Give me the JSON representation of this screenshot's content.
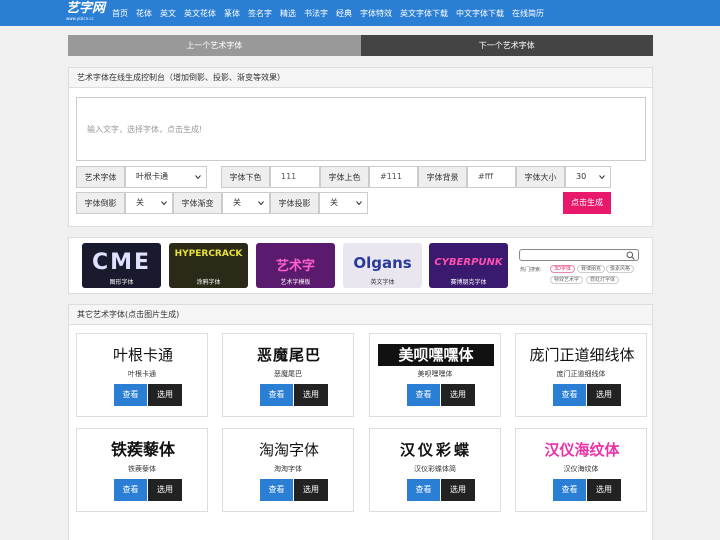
{
  "logo": {
    "main": "艺字网",
    "sub": "www.yizicn.cc"
  },
  "nav": [
    "首页",
    "花体",
    "英文",
    "英文花体",
    "篆体",
    "签名字",
    "精选",
    "书法字",
    "经典",
    "字体特效",
    "英文字体下载",
    "中文字体下载",
    "在线简历"
  ],
  "prev_label": "上一个艺术字体",
  "next_label": "下一个艺术字体",
  "generator": {
    "title": "艺术字体在线生成控制台（增加倒影、投影、渐变等效果）",
    "textarea_placeholder": "输入文字，选择字体，点击生成!",
    "font_label": "艺术字体",
    "font_value": "叶根卡通",
    "bottom_color_label": "字体下色",
    "bottom_color_value": "111",
    "top_color_label": "字体上色",
    "top_color_value": "#111",
    "bg_label": "字体背景",
    "bg_value": "#fff",
    "size_label": "字体大小",
    "size_value": "30",
    "reflect_label": "字体倒影",
    "reflect_value": "关",
    "gradient_label": "字体渐变",
    "gradient_value": "关",
    "shadow_label": "字体投影",
    "shadow_value": "关",
    "generate_label": "点击生成"
  },
  "banners": [
    {
      "art": "CME",
      "caption": "图形字体",
      "bg": "#1a1a2e"
    },
    {
      "art": "HYPERCRACK",
      "caption": "涂鸦字体",
      "bg": "#2b2a18"
    },
    {
      "art": "艺术字",
      "caption": "艺术字模板",
      "bg": "#5a1a6e"
    },
    {
      "art": "Olgans",
      "caption": "英文字体",
      "bg": "#e9e6f0"
    },
    {
      "art": "CYBERPUNK",
      "caption": "赛博朋克字体",
      "bg": "#3a1a6e"
    }
  ],
  "search": {
    "hot_label": "热门搜索:",
    "tags": [
      "3D字体",
      "赛博朋克",
      "像素风格",
      "特效艺术字",
      "霓虹灯字体"
    ]
  },
  "list": {
    "title": "其它艺术字体(点击图片生成)",
    "view_label": "查看",
    "use_label": "选用",
    "fonts": [
      {
        "sample": "叶根卡通",
        "name": "叶根卡通",
        "inverse": false
      },
      {
        "sample": "恶魔尾巴",
        "name": "恶魔尾巴",
        "inverse": false
      },
      {
        "sample": "美呗嘿嘿体",
        "name": "美呗嘿嘿体",
        "inverse": true
      },
      {
        "sample": "庞门正道细线体",
        "name": "庞门正道细线体",
        "inverse": false
      },
      {
        "sample": "铁蒺藜体",
        "name": "铁蒺藜体",
        "inverse": false
      },
      {
        "sample": "淘淘字体",
        "name": "淘淘字体",
        "inverse": false
      },
      {
        "sample": "汉仪彩蝶",
        "name": "汉仪彩蝶体简",
        "inverse": false
      },
      {
        "sample": "汉仪海纹体",
        "name": "汉仪海纹体",
        "inverse": false
      }
    ]
  },
  "colors": {
    "nav": "#2a7fd4",
    "generate": "#e8196a",
    "view": "#2a7fd4",
    "use": "#222222"
  }
}
